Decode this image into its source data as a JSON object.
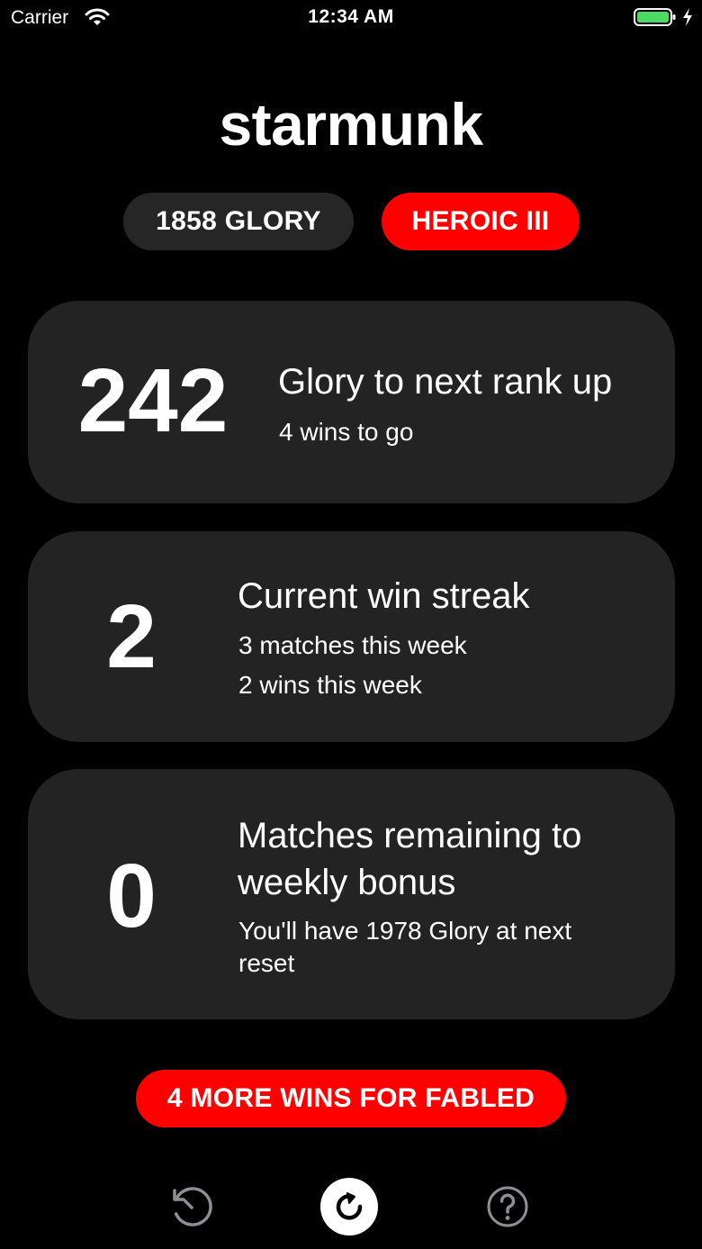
{
  "status_bar": {
    "carrier": "Carrier",
    "time": "12:34 AM",
    "icons": [
      "wifi-icon",
      "battery-icon",
      "charging-bolt-icon"
    ],
    "battery_color": "#4cd964"
  },
  "profile": {
    "username": "starmunk",
    "glory_label": "1858 GLORY",
    "rank_label": "HEROIC III"
  },
  "cards": {
    "rank_up": {
      "number": "242",
      "title": "Glory to next rank up",
      "subtitle": "4 wins to go"
    },
    "win_streak": {
      "number": "2",
      "title": "Current win streak",
      "matches_line": "3 matches this week",
      "wins_line": "2 wins this week"
    },
    "weekly_bonus": {
      "number": "0",
      "title": "Matches remaining to weekly bonus",
      "subtitle": "You'll have 1978 Glory at next reset"
    }
  },
  "bonus_button": {
    "label": "4 MORE WINS FOR FABLED"
  },
  "tab_bar": {
    "items": [
      {
        "icon": "history-icon"
      },
      {
        "icon": "refresh-icon"
      },
      {
        "icon": "help-icon"
      }
    ]
  },
  "colors": {
    "background": "#000000",
    "card": "#232323",
    "pill_dark": "#262626",
    "accent_red": "#ff0000",
    "text": "#ffffff",
    "icon_gray": "#8e8e93"
  }
}
